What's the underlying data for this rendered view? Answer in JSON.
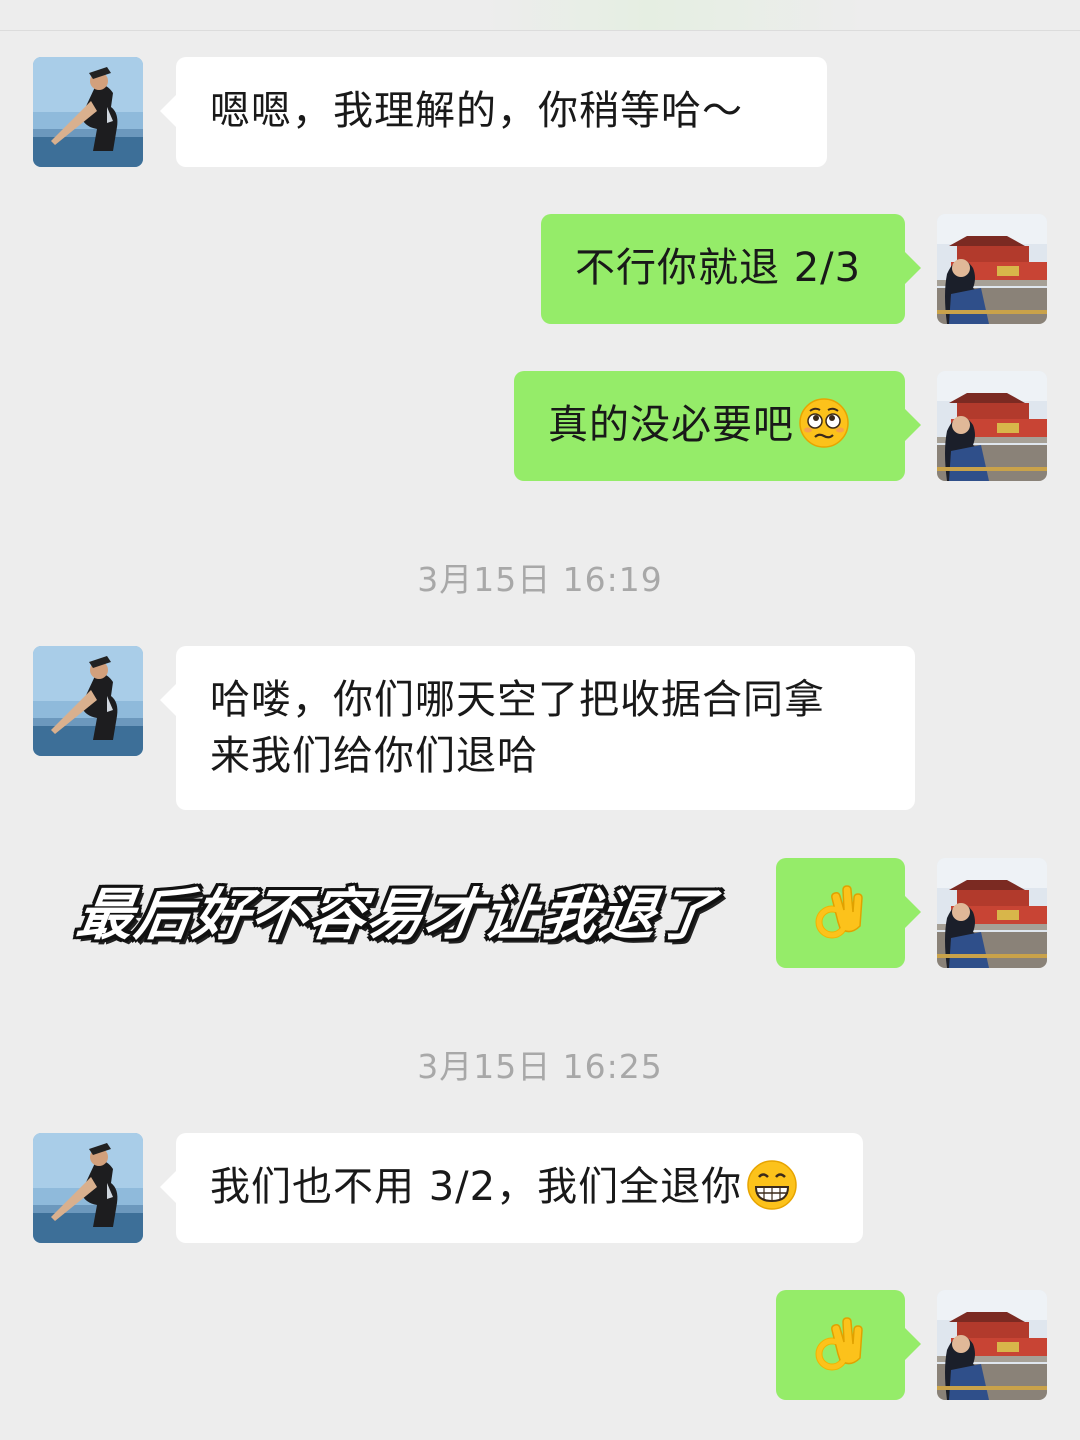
{
  "messages": [
    {
      "side": "in",
      "text": "嗯嗯，我理解的，你稍等哈～"
    },
    {
      "side": "out",
      "text": "不行你就退 2/3"
    },
    {
      "side": "out",
      "text": "真的没必要吧",
      "emoji": "woozy-pleading-face-icon"
    },
    {
      "timestamp": "3月15日 16:19"
    },
    {
      "side": "in",
      "text": "哈喽，你们哪天空了把收据合同拿\n来我们给你们退哈"
    },
    {
      "side": "out",
      "emoji": "ok-hand-icon"
    },
    {
      "timestamp": "3月15日 16:25"
    },
    {
      "side": "in",
      "text": "我们也不用 3/2，我们全退你",
      "emoji": "grinning-face-icon"
    },
    {
      "side": "out",
      "emoji": "ok-hand-icon"
    }
  ],
  "overlay_caption": "最后好不容易才让我退了",
  "colors": {
    "background": "#ededed",
    "incoming_bubble": "#ffffff",
    "outgoing_bubble": "#95ec69",
    "timestamp_text": "#a8a8a8"
  }
}
